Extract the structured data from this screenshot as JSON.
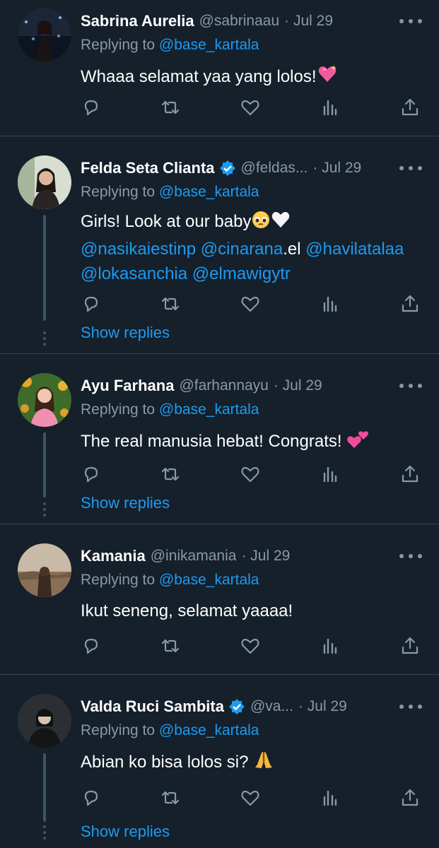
{
  "colors": {
    "background": "#15202b",
    "accent": "#1d9bf0",
    "muted": "#8899a6",
    "divider": "#38444d"
  },
  "tweets": [
    {
      "name": "Sabrina Aurelia",
      "handle": "@sabrinaau",
      "date": "· Jul 29",
      "verified": false,
      "replying_label": "Replying to",
      "replying_to": "@base_kartala",
      "lines": [
        [
          "Whaaa selamat yaa yang lolos!"
        ]
      ],
      "emoji_end": "sparkling-heart",
      "show_replies": ""
    },
    {
      "name": "Felda Seta Clianta",
      "handle": "@feldas...",
      "date": "· Jul 29",
      "verified": true,
      "replying_label": "Replying to",
      "replying_to": "@base_kartala",
      "text_line1": "Girls! Look at our baby",
      "mentions_line2": [
        "@nasikaiestinp",
        "@cinarana",
        ".el",
        "@havilatalaa"
      ],
      "mentions_line3": [
        "@lokasanchia",
        "@elmawigytr"
      ],
      "show_replies": "Show replies"
    },
    {
      "name": "Ayu Farhana",
      "handle": "@farhannayu",
      "date": "· Jul 29",
      "verified": false,
      "replying_label": "Replying to",
      "replying_to": "@base_kartala",
      "text": "The real manusia hebat! Congrats!",
      "show_replies": "Show replies"
    },
    {
      "name": "Kamania",
      "handle": "@inikamania",
      "date": "· Jul 29",
      "verified": false,
      "replying_label": "Replying to",
      "replying_to": "@base_kartala",
      "text": "Ikut seneng, selamat yaaaa!",
      "show_replies": ""
    },
    {
      "name": "Valda Ruci Sambita",
      "handle": "@va...",
      "date": "· Jul 29",
      "verified": true,
      "replying_label": "Replying to",
      "replying_to": "@base_kartala",
      "text": "Abian ko bisa lolos si?",
      "show_replies": "Show replies"
    }
  ],
  "icons": [
    "reply-icon",
    "retweet-icon",
    "like-icon",
    "analytics-icon",
    "share-icon",
    "more-icon",
    "verified-icon"
  ]
}
